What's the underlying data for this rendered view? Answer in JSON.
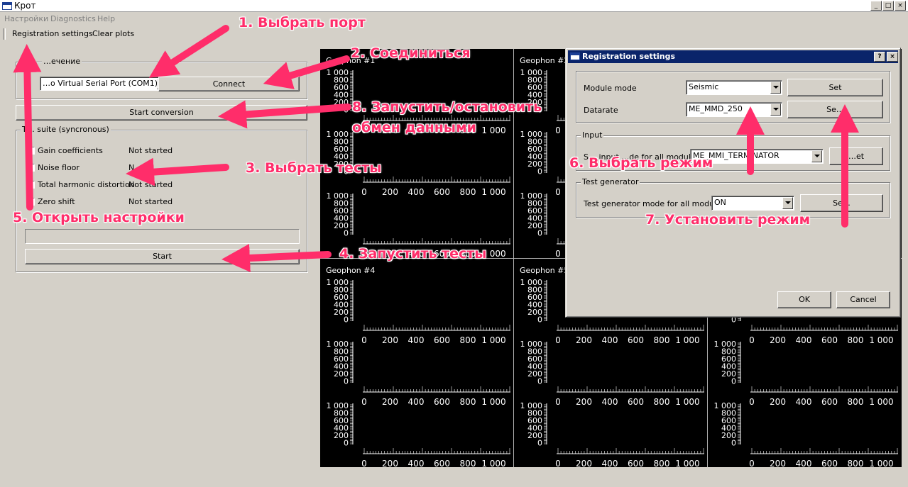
{
  "window": {
    "title": "Крот",
    "btn_min": "_",
    "btn_max": "□",
    "btn_close": "×"
  },
  "menu": [
    "Настройки",
    "Diagnostics",
    "Help"
  ],
  "toolbar": {
    "registration": "Registration settings",
    "clear": "Clear plots"
  },
  "connection": {
    "group_label": "…ечение",
    "port_value": "…o Virtual Serial Port (COM1)",
    "connect_label": "Connect"
  },
  "start_conversion_label": "Start conversion",
  "tests": {
    "group_label": "T… suite (syncronous)",
    "items": [
      {
        "name": "Gain coefficients",
        "status": "Not started"
      },
      {
        "name": "Noise floor",
        "status": "N…"
      },
      {
        "name": "Total harmonic distortion",
        "status": "Not started"
      },
      {
        "name": "Zero shift",
        "status": "Not started"
      }
    ],
    "start_label": "Start"
  },
  "plots": {
    "titles": [
      "Geophon #1",
      "Geophon #2",
      "",
      "Geophon #4",
      "Geophon #5",
      ""
    ],
    "y_ticks": [
      "1 000",
      "800",
      "600",
      "400",
      "200",
      "0"
    ],
    "x_ticks": [
      "0",
      "200",
      "400",
      "600",
      "800",
      "1 000"
    ]
  },
  "dialog": {
    "title": "Registration settings",
    "help_btn": "?",
    "close_btn": "×",
    "module_mode_label": "Module mode",
    "module_mode_value": "Seismic",
    "set1": "Set",
    "datarate_label": "Datarate",
    "datarate_value": "ME_MMD_250",
    "set2": "Se…",
    "input_group": "Input",
    "input_mode_label": "S… input …de for all modules",
    "input_mode_value": "ME_MMI_TERMINATOR",
    "set3": "…et",
    "gen_group": "Test generator",
    "gen_label": "Test generator mode for all modules",
    "gen_value": "ON",
    "set4": "Se…",
    "ok": "OK",
    "cancel": "Cancel"
  },
  "annotations": {
    "a1": "1. Выбрать порт",
    "a2": "2. Соединиться",
    "a8a": "8. Запустить/остановить",
    "a8b": "обмен данными",
    "a3": "3. Выбрать тесты",
    "a5": "5. Открыть настройки",
    "a4": "4. Запустить тесты",
    "a6": "6. Выбрать режим",
    "a7": "7. Установить режим",
    "arrow_color": "#ff2d6a"
  }
}
